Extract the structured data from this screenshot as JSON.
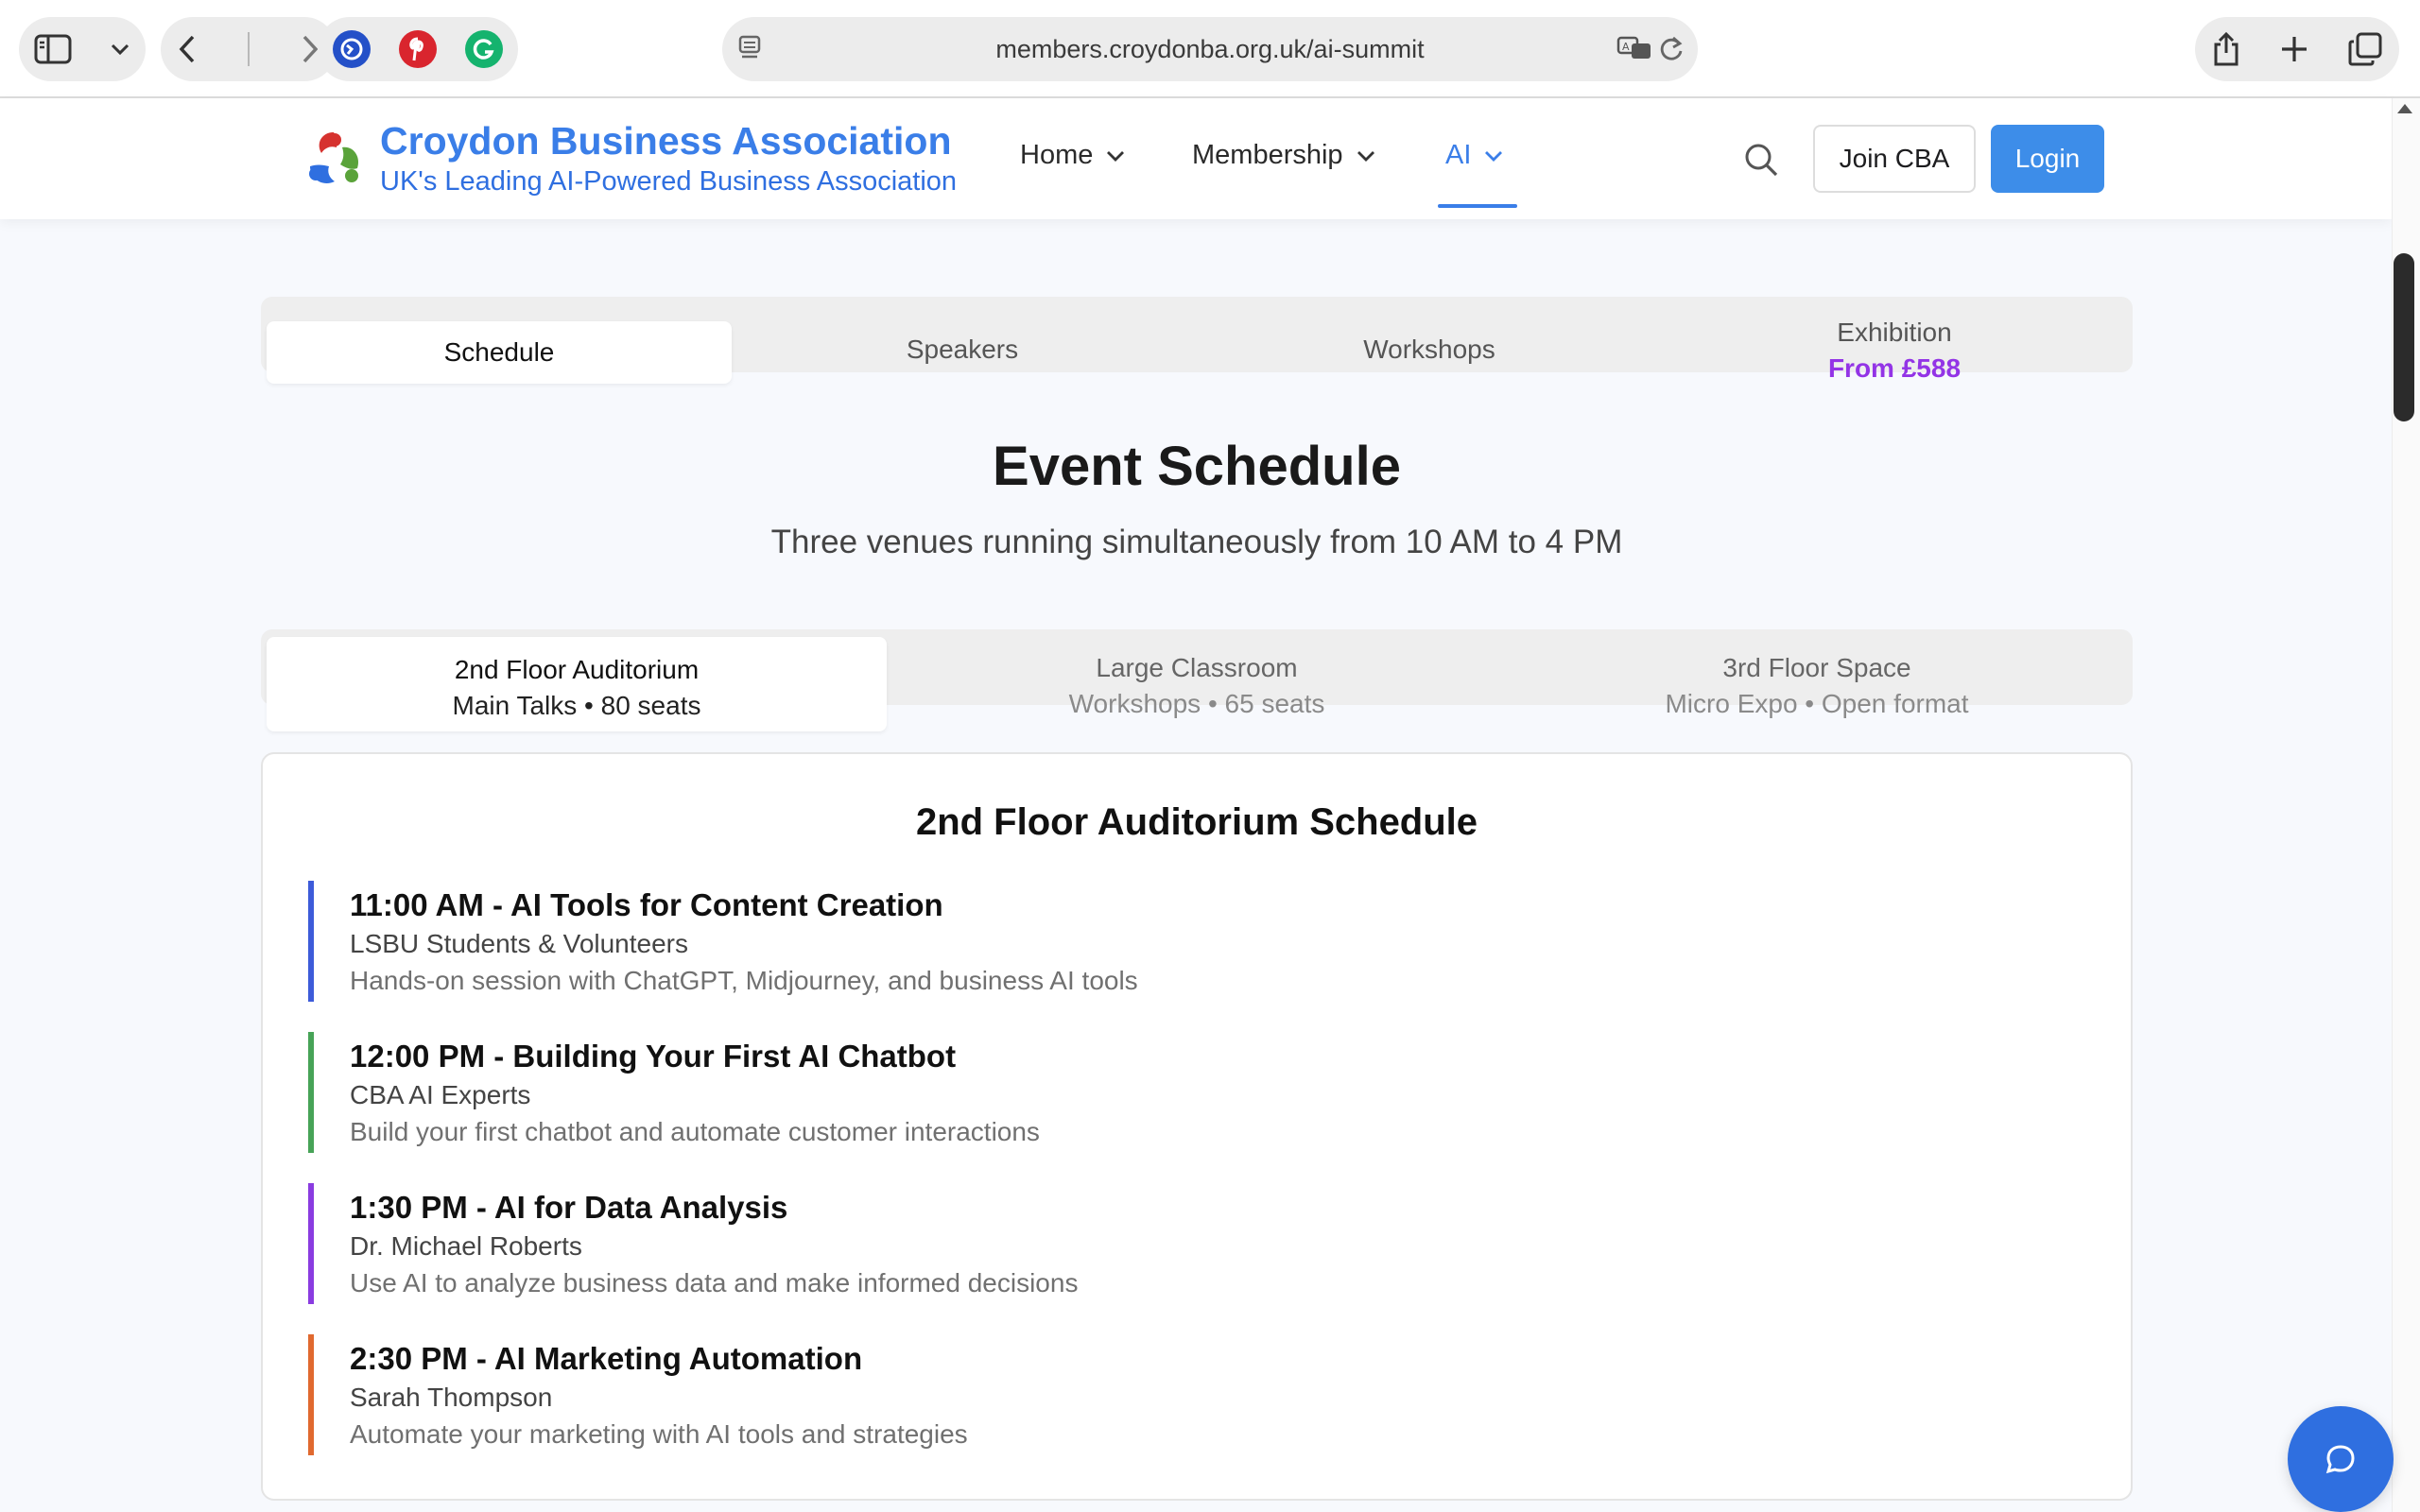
{
  "browser": {
    "url": "members.croydonba.org.uk/ai-summit"
  },
  "header": {
    "brand_name": "Croydon Business Association",
    "brand_tagline": "UK's Leading AI-Powered Business Association",
    "nav": [
      {
        "label": "Home"
      },
      {
        "label": "Membership"
      },
      {
        "label": "AI"
      }
    ],
    "join_label": "Join CBA",
    "login_label": "Login"
  },
  "section_tabs": [
    {
      "label": "Schedule"
    },
    {
      "label": "Speakers"
    },
    {
      "label": "Workshops"
    },
    {
      "label": "Exhibition",
      "sub": "From £588"
    }
  ],
  "event": {
    "title": "Event Schedule",
    "subtitle": "Three venues running simultaneously from 10 AM to 4 PM"
  },
  "venues": [
    {
      "name": "2nd Floor Auditorium",
      "meta": "Main Talks • 80 seats"
    },
    {
      "name": "Large Classroom",
      "meta": "Workshops • 65 seats"
    },
    {
      "name": "3rd Floor Space",
      "meta": "Micro Expo • Open format"
    }
  ],
  "schedule": {
    "title": "2nd Floor Auditorium Schedule",
    "sessions": [
      {
        "title": "11:00 AM - AI Tools for Content Creation",
        "speaker": "LSBU Students & Volunteers",
        "description": "Hands-on session with ChatGPT, Midjourney, and business AI tools",
        "color": "#3d5bd9"
      },
      {
        "title": "12:00 PM - Building Your First AI Chatbot",
        "speaker": "CBA AI Experts",
        "description": "Build your first chatbot and automate customer interactions",
        "color": "#47a357"
      },
      {
        "title": "1:30 PM - AI for Data Analysis",
        "speaker": "Dr. Michael Roberts",
        "description": "Use AI to analyze business data and make informed decisions",
        "color": "#8a3ce0"
      },
      {
        "title": "2:30 PM - AI Marketing Automation",
        "speaker": "Sarah Thompson",
        "description": "Automate your marketing with AI tools and strategies",
        "color": "#e0692f"
      }
    ]
  },
  "colors": {
    "brand_blue": "#3a7ee8",
    "login_bg": "#3d8de9",
    "price_purple": "#9334e6"
  },
  "icons": [
    "sidebar-icon",
    "chevron-down-icon",
    "back-icon",
    "forward-icon",
    "safari-extension-icon",
    "pinterest-icon",
    "grammarly-icon",
    "page-icon",
    "translate-icon",
    "reload-icon",
    "share-icon",
    "new-tab-icon",
    "tabs-overview-icon",
    "search-icon",
    "chat-icon"
  ]
}
